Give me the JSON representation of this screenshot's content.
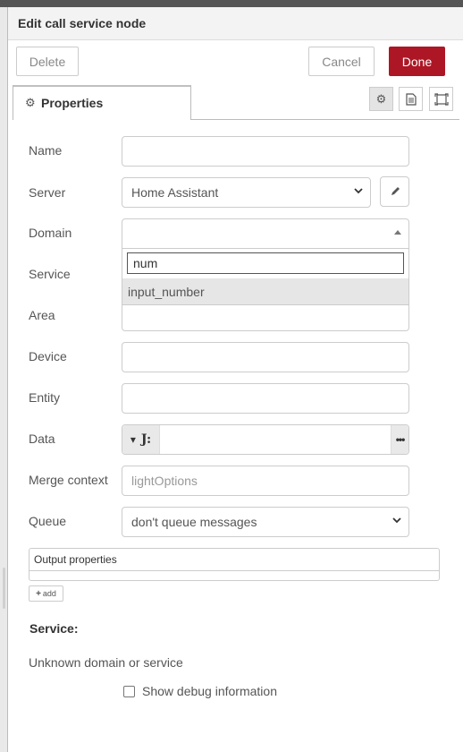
{
  "dialog": {
    "title": "Edit call service node",
    "delete_label": "Delete",
    "cancel_label": "Cancel",
    "done_label": "Done",
    "accent_color": "#ad1625"
  },
  "tabs": {
    "properties_label": "Properties",
    "icons": [
      "gear-icon",
      "document-icon",
      "frame-icon"
    ]
  },
  "form": {
    "name_label": "Name",
    "name_value": "",
    "server_label": "Server",
    "server_value": "Home Assistant",
    "domain_label": "Domain",
    "domain_search": "num",
    "domain_option": "input_number",
    "service_label": "Service",
    "area_label": "Area",
    "device_label": "Device",
    "entity_label": "Entity",
    "data_label": "Data",
    "data_type": "J:",
    "merge_context_label": "Merge context",
    "merge_context_placeholder": "lightOptions",
    "queue_label": "Queue",
    "queue_value": "don't queue messages"
  },
  "output": {
    "label": "Output properties",
    "add_label": "add"
  },
  "service_info": {
    "heading": "Service:",
    "message": "Unknown domain or service",
    "debug_label": "Show debug information"
  }
}
